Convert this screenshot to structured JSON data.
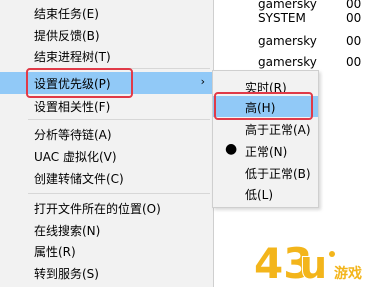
{
  "background_list": {
    "rows": [
      {
        "name": "gamersky",
        "num": "00"
      },
      {
        "name": "SYSTEM",
        "num": "00"
      },
      {
        "name": "gamersky",
        "num": "00"
      },
      {
        "name": "gamersky",
        "num": "00"
      }
    ]
  },
  "menu": {
    "items": [
      {
        "label": "结束任务(E)"
      },
      {
        "label": "提供反馈(B)"
      },
      {
        "label": "结束进程树(T)"
      },
      {
        "label": "设置优先级(P)"
      },
      {
        "label": "设置相关性(F)"
      },
      {
        "label": "分析等待链(A)"
      },
      {
        "label": "UAC 虚拟化(V)"
      },
      {
        "label": "创建转储文件(C)"
      },
      {
        "label": "打开文件所在的位置(O)"
      },
      {
        "label": "在线搜索(N)"
      },
      {
        "label": "属性(R)"
      },
      {
        "label": "转到服务(S)"
      }
    ],
    "submenu_arrow": "›"
  },
  "submenu": {
    "items": [
      {
        "label": "实时(R)"
      },
      {
        "label": "高(H)"
      },
      {
        "label": "高于正常(A)"
      },
      {
        "label": "正常(N)"
      },
      {
        "label": "低于正常(B)"
      },
      {
        "label": "低(L)"
      }
    ],
    "selected_bullet": "●"
  },
  "watermark": {
    "text": "游戏",
    "brand_color": "#f3b51b"
  },
  "colors": {
    "hover": "#91c9f7",
    "highlight_box": "#e03a48"
  }
}
